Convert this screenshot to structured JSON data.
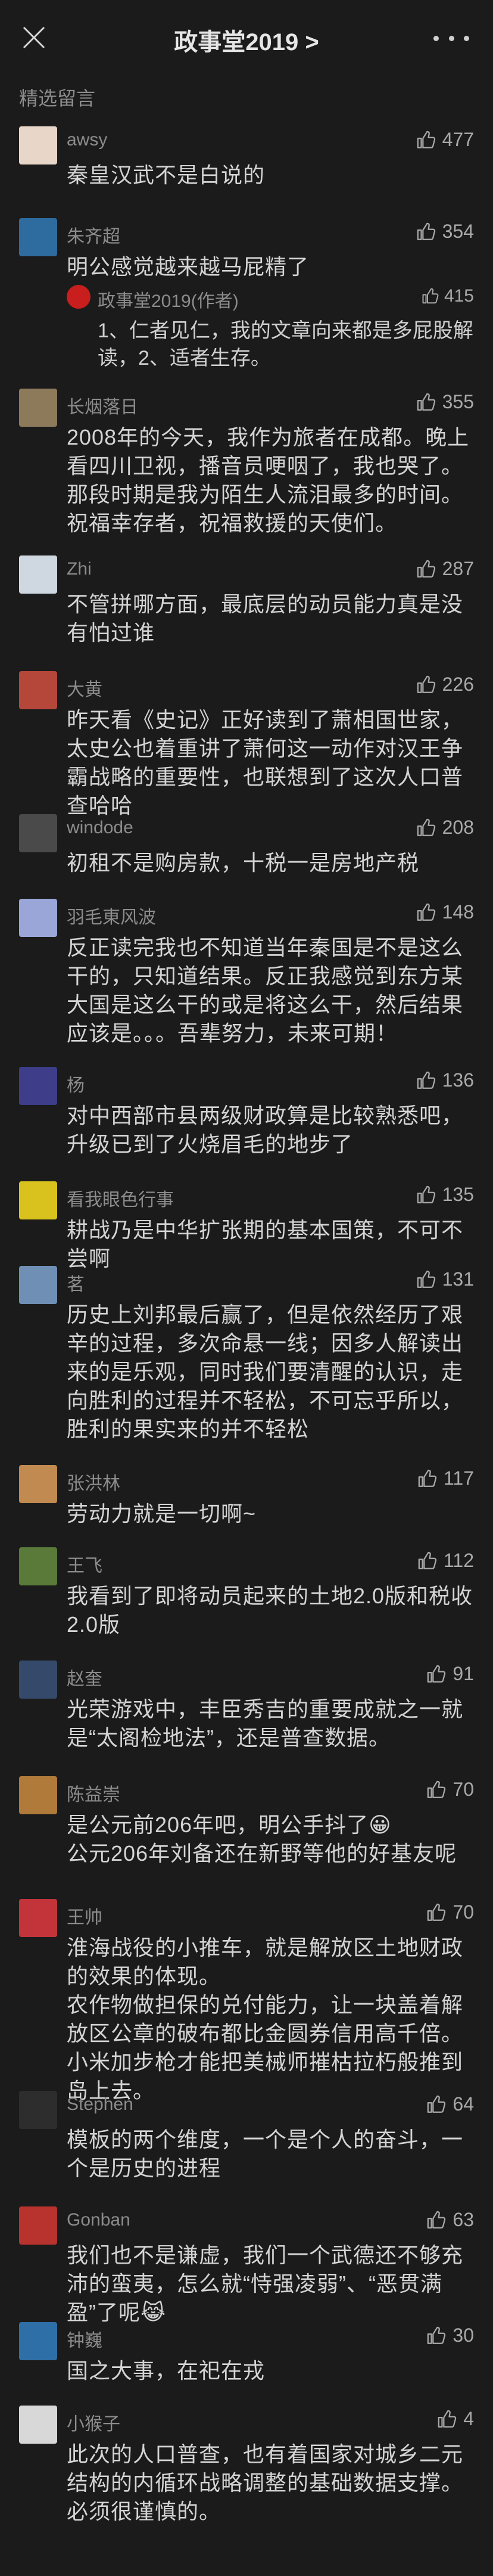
{
  "header": {
    "title": "政事堂2019 >"
  },
  "section_label": "精选留言",
  "comments": [
    {
      "name": "awsy",
      "likes": "477",
      "text": "秦皇汉武不是白说的",
      "avatar_color": "#e8d6c8"
    },
    {
      "name": "朱齐超",
      "likes": "354",
      "text": "明公感觉越来越马屁精了",
      "avatar_color": "#2e6b9e",
      "reply": {
        "name": "政事堂2019(作者)",
        "likes": "415",
        "text": "1、仁者见仁，我的文章向来都是多屁股解读，2、适者生存。"
      }
    },
    {
      "name": "长烟落日",
      "likes": "355",
      "text": "2008年的今天，我作为旅者在成都。晚上看四川卫视，播音员哽咽了，我也哭了。那段时期是我为陌生人流泪最多的时间。祝福幸存者，祝福救援的天使们。",
      "avatar_color": "#8c7a5a"
    },
    {
      "name": "Zhi",
      "likes": "287",
      "text": "不管拼哪方面，最底层的动员能力真是没有怕过谁",
      "avatar_color": "#cfd8e0"
    },
    {
      "name": "大黄",
      "likes": "226",
      "text": "昨天看《史记》正好读到了萧相国世家，太史公也着重讲了萧何这一动作对汉王争霸战略的重要性，也联想到了这次人口普查哈哈",
      "avatar_color": "#b5473a"
    },
    {
      "name": "windode",
      "likes": "208",
      "text": "初租不是购房款，十税一是房地产税",
      "avatar_color": "#4a4a4a"
    },
    {
      "name": "羽毛東风波",
      "likes": "148",
      "text": "反正读完我也不知道当年秦国是不是这么干的，只知道结果。反正我感觉到东方某大国是这么干的或是将这么干，然后结果应该是。。。吾辈努力，未来可期！",
      "avatar_color": "#9aa6d8"
    },
    {
      "name": "杨",
      "likes": "136",
      "text": "对中西部市县两级财政算是比较熟悉吧，升级已到了火烧眉毛的地步了",
      "avatar_color": "#3d3d8a"
    },
    {
      "name": "看我眼色行事",
      "likes": "135",
      "text": "耕战乃是中华扩张期的基本国策，不可不尝啊",
      "avatar_color": "#d9c21e"
    },
    {
      "name": "茗",
      "likes": "131",
      "text": "历史上刘邦最后赢了，但是依然经历了艰辛的过程，多次命悬一线；因多人解读出来的是乐观，同时我们要清醒的认识，走向胜利的过程并不轻松，不可忘乎所以，胜利的果实来的并不轻松",
      "avatar_color": "#6f8fb5"
    },
    {
      "name": "张洪林",
      "likes": "117",
      "text": "劳动力就是一切啊~",
      "avatar_color": "#c08a50"
    },
    {
      "name": "王飞",
      "likes": "112",
      "text": "我看到了即将动员起来的土地2.0版和税收2.0版",
      "avatar_color": "#5a7a3a"
    },
    {
      "name": "赵奎",
      "likes": "91",
      "text": "光荣游戏中，丰臣秀吉的重要成就之一就是“太阁检地法”，还是普查数据。",
      "avatar_color": "#354a6b"
    },
    {
      "name": "陈益崇",
      "likes": "70",
      "text": "是公元前206年吧，明公手抖了😀\n公元206年刘备还在新野等他的好基友呢",
      "avatar_color": "#b07a3a"
    },
    {
      "name": "王帅",
      "likes": "70",
      "text": "淮海战役的小推车，就是解放区土地财政的效果的体现。\n农作物做担保的兑付能力，让一块盖着解放区公章的破布都比金圆券信用高千倍。小米加步枪才能把美械师摧枯拉朽般推到岛上去。",
      "avatar_color": "#c2343a"
    },
    {
      "name": "Stephen",
      "likes": "64",
      "text": "模板的两个维度，一个是个人的奋斗，一个是历史的进程",
      "avatar_color": "#2d2d2d"
    },
    {
      "name": "Gonban",
      "likes": "63",
      "text": "我们也不是谦虚，我们一个武德还不够充沛的蛮夷，怎么就“恃强凌弱”、“恶贯满盈”了呢😹",
      "avatar_color": "#b8322e"
    },
    {
      "name": "钟巍",
      "likes": "30",
      "text": "国之大事，在祀在戎",
      "avatar_color": "#2f6fa8"
    },
    {
      "name": "小猴子",
      "likes": "4",
      "text": "此次的人口普查，也有着国家对城乡二元结构的内循环战略调整的基础数据支撑。必须很谨慎的。",
      "avatar_color": "#d8d8d8"
    }
  ]
}
